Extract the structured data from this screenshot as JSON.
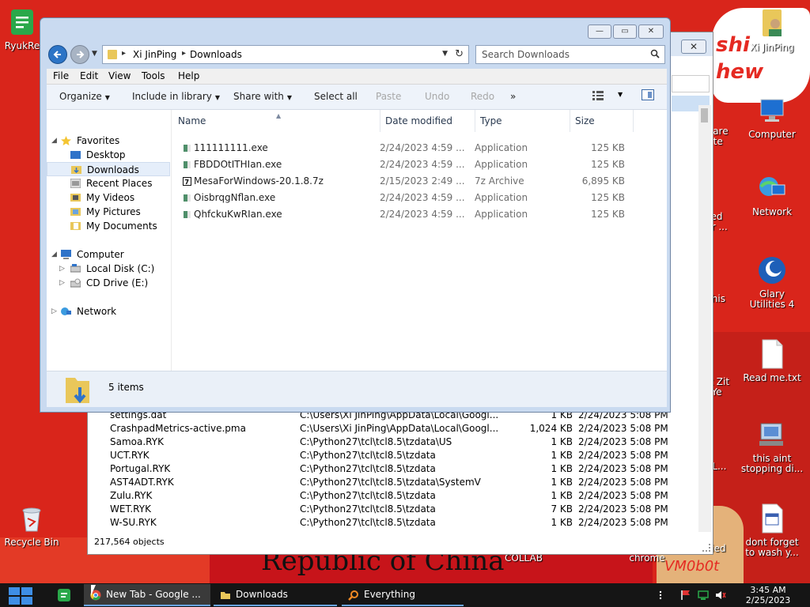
{
  "desktop": {
    "wallpaper_banner": "Republic of China",
    "wallpaper_text": "shi\nhew",
    "wallpaper_author": "VM0b0t",
    "icons": [
      {
        "name": "ryukreadme",
        "label": "RyukRe",
        "icon": "green-doc-icon"
      },
      {
        "name": "recycle-bin",
        "label": "Recycle Bin",
        "icon": "recycle-bin-icon"
      },
      {
        "name": "xijinping-user",
        "label": "Xi JinPing",
        "icon": "user-folder-icon"
      },
      {
        "name": "computer",
        "label": "Computer",
        "icon": "computer-icon"
      },
      {
        "name": "network",
        "label": "Network",
        "icon": "network-icon"
      },
      {
        "name": "glary-utilities",
        "label": "Glary Utilities 4",
        "icon": "glary-icon"
      },
      {
        "name": "read-me",
        "label": "Read me.txt",
        "icon": "text-file-icon"
      },
      {
        "name": "this-aint-stopping",
        "label": "this aint stopping di...",
        "icon": "computer-tools-icon"
      },
      {
        "name": "dont-forget",
        "label": "dont forget to wash y...",
        "icon": "calendar-doc-icon"
      },
      {
        "name": "partial-ware",
        "label": "ware\nite",
        "icon": "app-icon"
      },
      {
        "name": "partial-ed",
        "label": "ed\ner ...",
        "icon": "app-icon"
      },
      {
        "name": "partial-this",
        "label": "this",
        "icon": "doc-icon"
      },
      {
        "name": "partial-zit",
        "label": "at Zit\nYe",
        "icon": "app-icon"
      },
      {
        "name": "partial-ll",
        "label": "LL...",
        "icon": "disc-icon"
      },
      {
        "name": "partial-ried",
        "label": "ried",
        "icon": "star-icon"
      },
      {
        "name": "partial-collab",
        "label": "COLLAB",
        "icon": "app-icon"
      },
      {
        "name": "partial-chrome",
        "label": "chrome",
        "icon": "chrome-icon"
      }
    ]
  },
  "back_window": {
    "status": "217,564 objects",
    "close_label": "✕",
    "rows": [
      {
        "name": "settings.dat",
        "path": "C:\\Users\\Xi JinPing\\AppData\\Local\\Googl...",
        "size": "1 KB",
        "date": "2/24/2023 5:08 PM"
      },
      {
        "name": "CrashpadMetrics-active.pma",
        "path": "C:\\Users\\Xi JinPing\\AppData\\Local\\Googl...",
        "size": "1,024 KB",
        "date": "2/24/2023 5:08 PM"
      },
      {
        "name": "Samoa.RYK",
        "path": "C:\\Python27\\tcl\\tcl8.5\\tzdata\\US",
        "size": "1 KB",
        "date": "2/24/2023 5:08 PM"
      },
      {
        "name": "UCT.RYK",
        "path": "C:\\Python27\\tcl\\tcl8.5\\tzdata",
        "size": "1 KB",
        "date": "2/24/2023 5:08 PM"
      },
      {
        "name": "Portugal.RYK",
        "path": "C:\\Python27\\tcl\\tcl8.5\\tzdata",
        "size": "1 KB",
        "date": "2/24/2023 5:08 PM"
      },
      {
        "name": "AST4ADT.RYK",
        "path": "C:\\Python27\\tcl\\tcl8.5\\tzdata\\SystemV",
        "size": "1 KB",
        "date": "2/24/2023 5:08 PM"
      },
      {
        "name": "Zulu.RYK",
        "path": "C:\\Python27\\tcl\\tcl8.5\\tzdata",
        "size": "1 KB",
        "date": "2/24/2023 5:08 PM"
      },
      {
        "name": "WET.RYK",
        "path": "C:\\Python27\\tcl\\tcl8.5\\tzdata",
        "size": "7 KB",
        "date": "2/24/2023 5:08 PM"
      },
      {
        "name": "W-SU.RYK",
        "path": "C:\\Python27\\tcl\\tcl8.5\\tzdata",
        "size": "1 KB",
        "date": "2/24/2023 5:08 PM"
      }
    ]
  },
  "explorer": {
    "controls": {
      "minimize": "—",
      "maximize": "▭",
      "close": "✕"
    },
    "address": {
      "crumbs": [
        "Xi JinPing",
        "Downloads"
      ]
    },
    "search": {
      "placeholder": "Search Downloads"
    },
    "menu": [
      "File",
      "Edit",
      "View",
      "Tools",
      "Help"
    ],
    "toolbar": {
      "organize": "Organize",
      "include": "Include in library",
      "share": "Share with",
      "select_all": "Select all",
      "paste": "Paste",
      "undo": "Undo",
      "redo": "Redo",
      "more": "»"
    },
    "nav": {
      "favorites": "Favorites",
      "desktop": "Desktop",
      "downloads": "Downloads",
      "recent": "Recent Places",
      "videos": "My Videos",
      "pictures": "My Pictures",
      "documents": "My Documents",
      "computer": "Computer",
      "local_disk": "Local Disk (C:)",
      "cd_drive": "CD Drive (E:)",
      "network": "Network"
    },
    "columns": {
      "name": "Name",
      "date": "Date modified",
      "type": "Type",
      "size": "Size"
    },
    "files": [
      {
        "name": "111111111.exe",
        "date": "2/24/2023 4:59 ...",
        "type": "Application",
        "size": "125 KB",
        "icon": "exe-icon"
      },
      {
        "name": "FBDDOtITHIan.exe",
        "date": "2/24/2023 4:59 ...",
        "type": "Application",
        "size": "125 KB",
        "icon": "exe-icon"
      },
      {
        "name": "MesaForWindows-20.1.8.7z",
        "date": "2/15/2023 2:49 ...",
        "type": "7z Archive",
        "size": "6,895 KB",
        "icon": "7z-archive-icon"
      },
      {
        "name": "OisbrqgNflan.exe",
        "date": "2/24/2023 4:59 ...",
        "type": "Application",
        "size": "125 KB",
        "icon": "exe-icon"
      },
      {
        "name": "QhfckuKwRIan.exe",
        "date": "2/24/2023 4:59 ...",
        "type": "Application",
        "size": "125 KB",
        "icon": "exe-icon"
      }
    ],
    "details": {
      "count": "5 items"
    }
  },
  "taskbar": {
    "tasks": [
      {
        "label": "New Tab - Google ...",
        "icon": "chrome-icon"
      },
      {
        "label": "Downloads",
        "icon": "folder-icon"
      },
      {
        "label": "Everything",
        "icon": "search-icon"
      }
    ],
    "clock_time": "3:45 AM",
    "clock_date": "2/25/2023"
  },
  "colors": {
    "wallpaper": "#d9251b",
    "accent": "#2c74c6",
    "taskbar": "#151515"
  }
}
